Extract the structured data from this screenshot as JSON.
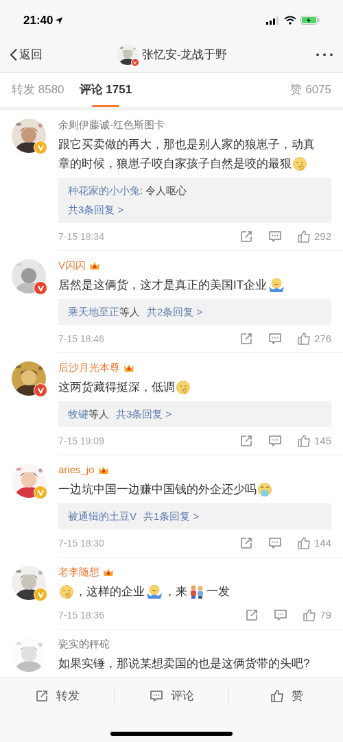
{
  "status_bar": {
    "time": "21:40"
  },
  "nav": {
    "back": "返回",
    "title": "张忆安-龙战于野"
  },
  "tabs": [
    {
      "label": "转发 8580",
      "selected": false
    },
    {
      "label": "评论 1751",
      "selected": true
    },
    {
      "label": "赞 6075",
      "selected": false
    }
  ],
  "comments": [
    {
      "user": "余则伊藤诚-红色斯图卡",
      "vip": false,
      "color": "#f5b21f",
      "content": [
        {
          "kind": "text",
          "text": "跟它买卖做的再大，那也是别人家的狼崽子，动真"
        },
        {
          "kind": "text",
          "text": "章的时候，狼崽子咬自家孩子自然是咬的最狠"
        },
        {
          "kind": "shush"
        }
      ],
      "replies": [
        [
          {
            "kind": "name",
            "text": "种花家的小小兔"
          },
          {
            "kind": "text",
            "text": ": 令人呕心"
          }
        ],
        [
          {
            "kind": "link",
            "text": "共3条回复 >"
          }
        ]
      ],
      "time": "7-15 18:34",
      "likes": "292"
    },
    {
      "user": "V闪闪",
      "vip": true,
      "color": "#e5432c",
      "content": [
        {
          "kind": "text",
          "text": "居然是这俩货，这才是真正的美国IT企业"
        },
        {
          "kind": "shrug"
        }
      ],
      "replies": [
        [
          {
            "kind": "name",
            "text": "乘天地至正"
          },
          {
            "kind": "text",
            "text": "等人"
          },
          {
            "kind": "link",
            "text": "共2条回复 >"
          }
        ]
      ],
      "time": "7-15 18:46",
      "likes": "276"
    },
    {
      "user": "后沙月光本尊",
      "vip": true,
      "color": "#e5432c",
      "content": [
        {
          "kind": "text",
          "text": "这两货藏得挺深，低调"
        },
        {
          "kind": "shush"
        }
      ],
      "replies": [
        [
          {
            "kind": "name",
            "text": "牧键"
          },
          {
            "kind": "text",
            "text": "等人"
          },
          {
            "kind": "link",
            "text": "共3条回复 >"
          }
        ]
      ],
      "time": "7-15 19:09",
      "likes": "145"
    },
    {
      "user": "aries_jo",
      "vip": true,
      "color": "#f5b21f",
      "content": [
        {
          "kind": "text",
          "text": "一边坑中国一边赚中国钱的外企还少吗"
        },
        {
          "kind": "puke"
        }
      ],
      "replies": [
        [
          {
            "kind": "name",
            "text": "被通辑的土豆V"
          },
          {
            "kind": "link",
            "text": "共1条回复 >"
          }
        ]
      ],
      "time": "7-15 18:30",
      "likes": "144"
    },
    {
      "user": "老李随想",
      "vip": true,
      "color": "#f5b21f",
      "content": [
        {
          "kind": "shush"
        },
        {
          "kind": "text",
          "text": "，这样的企业"
        },
        {
          "kind": "shrug"
        },
        {
          "kind": "text",
          "text": "，来"
        },
        {
          "kind": "people"
        },
        {
          "kind": "text",
          "text": "一发"
        }
      ],
      "time": "7-15 18:36",
      "likes": "79"
    },
    {
      "user": "瓷实的秤砣",
      "vip": false,
      "content": [
        {
          "kind": "text",
          "text": "如果实锤，那说某想卖国的也是这俩货带的头吧?"
        }
      ]
    }
  ],
  "toolbar": [
    {
      "kind": "share",
      "label": "转发"
    },
    {
      "kind": "comment",
      "label": "评论"
    },
    {
      "kind": "like",
      "label": "赞"
    }
  ]
}
